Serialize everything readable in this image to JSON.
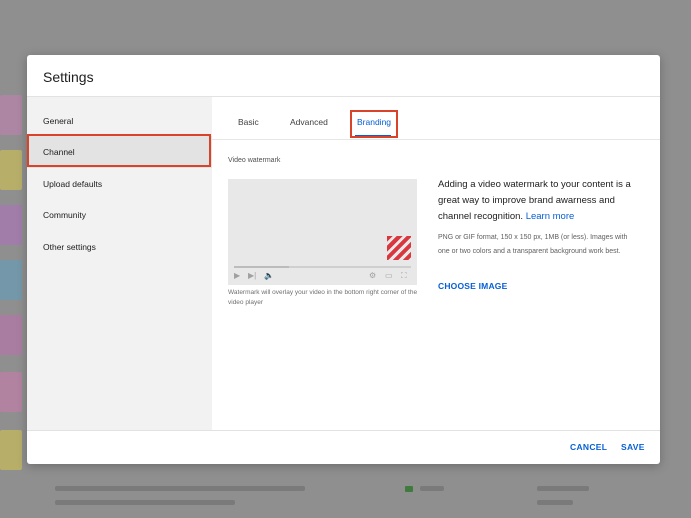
{
  "dialog": {
    "title": "Settings"
  },
  "sidebar": {
    "items": [
      {
        "label": "General"
      },
      {
        "label": "Channel"
      },
      {
        "label": "Upload defaults"
      },
      {
        "label": "Community"
      },
      {
        "label": "Other settings"
      }
    ],
    "selected": "Channel"
  },
  "tabs": [
    {
      "label": "Basic"
    },
    {
      "label": "Advanced"
    },
    {
      "label": "Branding"
    }
  ],
  "active_tab": "Branding",
  "branding": {
    "section_label": "Video watermark",
    "preview_caption": "Watermark will overlay your video in the bottom right corner of the video player",
    "description": "Adding a video watermark to your content is a great way to improve brand awarness and channel recognition.",
    "learn_more": "Learn more",
    "requirements": "PNG or GIF format, 150 x 150 px, 1MB (or less). Images with one or two colors and a transparent background work best.",
    "choose_image": "CHOOSE IMAGE"
  },
  "player_icons": [
    "play-icon",
    "next-icon",
    "volume-icon",
    "settings-icon",
    "theater-icon",
    "fullscreen-icon"
  ],
  "footer": {
    "cancel": "CANCEL",
    "save": "SAVE"
  },
  "colors": {
    "accent": "#065fd4",
    "highlight": "#d9432a",
    "watermark": "#d9363e"
  }
}
